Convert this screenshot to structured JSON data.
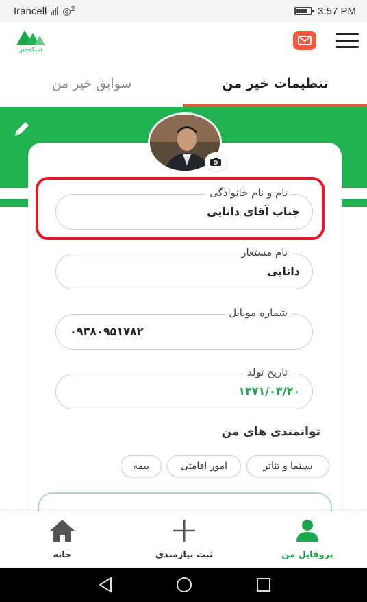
{
  "status_bar": {
    "carrier": "Irancell",
    "network": "2",
    "time": "3:57 PM",
    "battery_level": 0.8
  },
  "header": {
    "logo_text": "شبکه‌خیر"
  },
  "tabs": [
    {
      "label": "تنظیمات خیر من",
      "active": true
    },
    {
      "label": "سوابق خیر من",
      "active": false
    }
  ],
  "profile": {
    "fields": [
      {
        "label": "نام و نام خانوادگی",
        "value": "جناب آقای دانایی"
      },
      {
        "label": "نام مستعار",
        "value": "دانایی"
      },
      {
        "label": "شماره موبایل",
        "value": "۰۹۳۸۰۹۵۱۷۸۲"
      },
      {
        "label": "تاریخ تولد",
        "value": "۱۳۷۱/۰۳/۲۰"
      }
    ],
    "abilities_title": "توانمندی های من",
    "abilities": [
      "سینما و تئاتر",
      "امور اقامتی",
      "بیمه"
    ]
  },
  "bottom_nav": [
    {
      "label": "پروفایل من",
      "icon": "user-icon",
      "active": true
    },
    {
      "label": "ثبت نیازمندی",
      "icon": "plus-icon",
      "active": false
    },
    {
      "label": "خانه",
      "icon": "home-icon",
      "active": false
    }
  ],
  "colors": {
    "green": "#21b252",
    "accent": "#e25a34",
    "highlight": "#e0192b"
  }
}
